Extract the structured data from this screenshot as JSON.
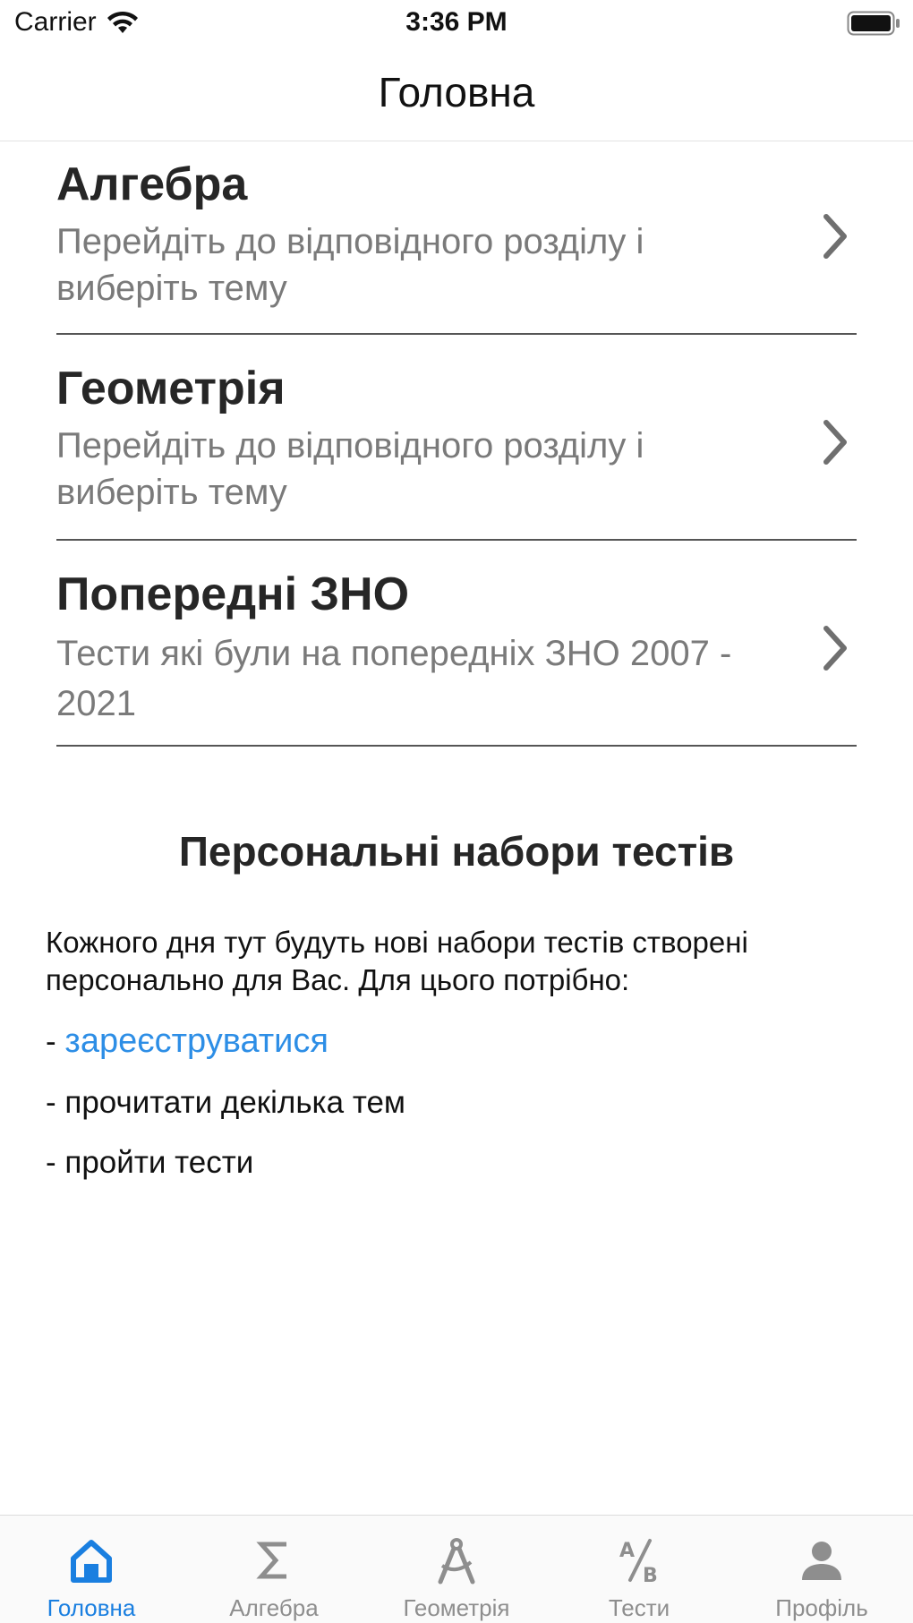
{
  "status_bar": {
    "carrier": "Carrier",
    "time": "3:36 PM"
  },
  "nav": {
    "title": "Головна"
  },
  "menu": [
    {
      "title": "Алгебра",
      "subtitle": "Перейдіть до відповідного розділу і виберіть тему"
    },
    {
      "title": "Геометрія",
      "subtitle": "Перейдіть до відповідного розділу і виберіть тему"
    },
    {
      "title": "Попередні ЗНО",
      "subtitle": "Тести які були на попередніх ЗНО 2007 - 2021"
    }
  ],
  "personal": {
    "title": "Персональні набори тестів",
    "body": "Кожного дня тут будуть нові набори тестів створені персонально для Вас. Для цього потрібно:",
    "dash": "-",
    "register_link": "зареєструватися",
    "step2": "- прочитати декілька тем",
    "step3": "- пройти тести"
  },
  "tabs": [
    {
      "label": "Головна",
      "icon": "home-icon",
      "active": true
    },
    {
      "label": "Алгебра",
      "icon": "sigma-icon",
      "active": false
    },
    {
      "label": "Геометрія",
      "icon": "compass-icon",
      "active": false
    },
    {
      "label": "Тести",
      "icon": "ab-tests-icon",
      "active": false
    },
    {
      "label": "Профіль",
      "icon": "person-icon",
      "active": false
    }
  ],
  "colors": {
    "accent": "#1a7fe0",
    "link": "#2d8ee6",
    "inactive_tab": "#8e8e8e",
    "subtitle": "#7a7a7a"
  }
}
